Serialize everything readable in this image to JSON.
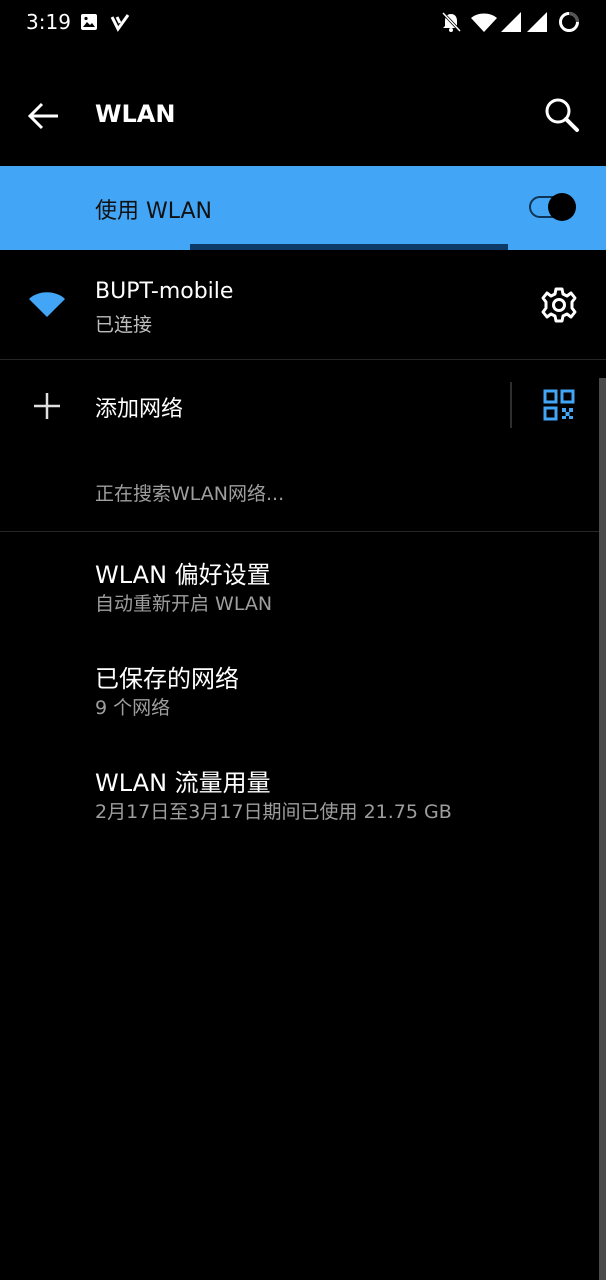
{
  "status_bar": {
    "time": "3:19",
    "left_icons": [
      "image-icon",
      "v-check-icon"
    ],
    "right_icons": [
      "bell-off-icon",
      "wifi-signal-icon",
      "cell-signal-icon",
      "cell-signal-icon",
      "battery-ring-icon"
    ]
  },
  "app_bar": {
    "title": "WLAN",
    "back_icon": "back-arrow-icon",
    "search_icon": "search-icon"
  },
  "master_switch": {
    "label": "使用 WLAN",
    "on": true,
    "background": "#42a5f5"
  },
  "connected_network": {
    "name": "BUPT-mobile",
    "status": "已连接",
    "icon": "wifi-icon",
    "settings_icon": "gear-icon",
    "icon_color": "#42a5f5"
  },
  "add_network": {
    "label": "添加网络",
    "icon": "plus-icon",
    "qr_icon": "qr-code-icon"
  },
  "searching_text": "正在搜索WLAN网络...",
  "preferences": [
    {
      "title": "WLAN 偏好设置",
      "subtitle": "自动重新开启 WLAN"
    },
    {
      "title": "已保存的网络",
      "subtitle": "9 个网络"
    },
    {
      "title": "WLAN 流量用量",
      "subtitle": "2月17日至3月17日期间已使用 21.75 GB"
    }
  ]
}
